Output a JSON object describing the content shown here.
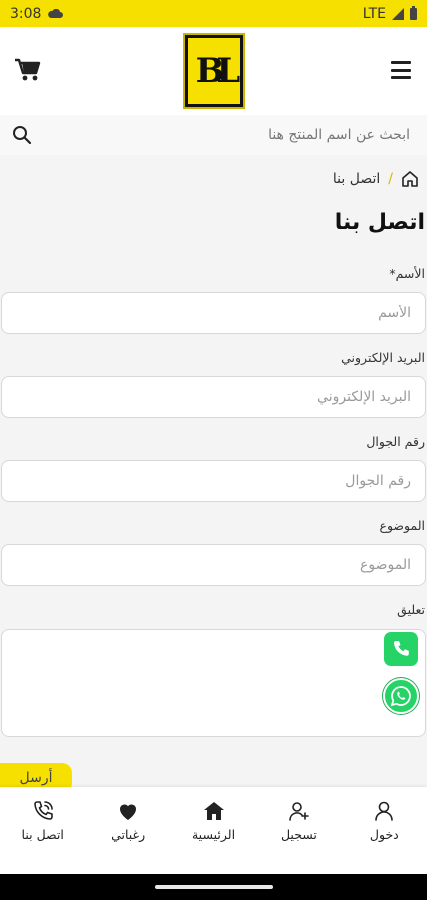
{
  "status_bar": {
    "time": "3:08",
    "network": "LTE"
  },
  "search": {
    "placeholder": "ابحث عن اسم المنتج هنا"
  },
  "breadcrumb": {
    "separator": "/",
    "current": "اتصل بنا"
  },
  "page_title": "اتصل بنا",
  "form": {
    "fields": [
      {
        "label": "الأسم*",
        "placeholder": "الأسم"
      },
      {
        "label": "البريد الإلكتروني",
        "placeholder": "البريد الإلكتروني"
      },
      {
        "label": "رقم الجوال",
        "placeholder": "رقم الجوال"
      },
      {
        "label": "الموضوع",
        "placeholder": "الموضوع"
      },
      {
        "label": "تعليق"
      }
    ],
    "submit_label": "أرسل"
  },
  "bottom_nav": [
    {
      "label": "اتصل بنا",
      "icon": "phone-call-icon"
    },
    {
      "label": "رغباتي",
      "icon": "heart-icon"
    },
    {
      "label": "الرئيسية",
      "icon": "home-icon"
    },
    {
      "label": "تسجيل",
      "icon": "user-plus-icon"
    },
    {
      "label": "دخول",
      "icon": "user-icon"
    }
  ],
  "colors": {
    "brand_yellow": "#f6e000",
    "whatsapp_green": "#25d366"
  }
}
